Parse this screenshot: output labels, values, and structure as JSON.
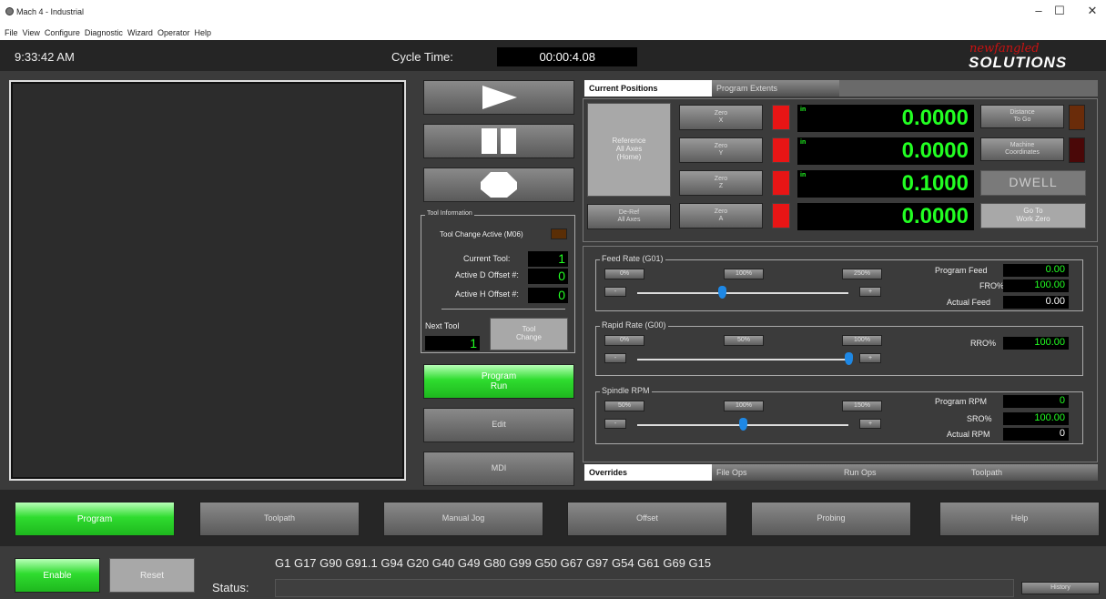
{
  "window": {
    "title": "Mach 4 - Industrial",
    "minimize": "–",
    "maximize": "☐",
    "close": "✕"
  },
  "menu": [
    "File",
    "View",
    "Configure",
    "Diagnostic",
    "Wizard",
    "Operator",
    "Help"
  ],
  "header": {
    "clock": "9:33:42 AM",
    "cycle_label": "Cycle Time:",
    "cycle_value": "00:00:4.08",
    "logo_top": "newfangled",
    "logo_bottom": "SOLUTIONS"
  },
  "controls": {
    "program_run": [
      "Program",
      "Run"
    ],
    "edit": "Edit",
    "mdi": "MDI"
  },
  "tool_info": {
    "legend": "Tool Information",
    "tool_change_active": "Tool Change Active (M06)",
    "current_tool_label": "Current Tool:",
    "current_tool": "1",
    "d_offset_label": "Active D Offset #:",
    "d_offset": "0",
    "h_offset_label": "Active H Offset #:",
    "h_offset": "0",
    "next_tool_label": "Next Tool",
    "next_tool": "1",
    "tool_change": [
      "Tool",
      "Change"
    ]
  },
  "positions": {
    "tabs": [
      "Current Positions",
      "Program Extents"
    ],
    "reference": [
      "Reference",
      "All Axes",
      "(Home)"
    ],
    "deref": [
      "De-Ref",
      "All Axes"
    ],
    "axes": [
      {
        "zero": [
          "Zero",
          "X"
        ],
        "unit": "in",
        "value": "0.0000"
      },
      {
        "zero": [
          "Zero",
          "Y"
        ],
        "unit": "in",
        "value": "0.0000"
      },
      {
        "zero": [
          "Zero",
          "Z"
        ],
        "unit": "in",
        "value": "0.1000"
      },
      {
        "zero": [
          "Zero",
          "A"
        ],
        "unit": "",
        "value": "0.0000"
      }
    ],
    "distance": [
      "Distance",
      "To Go"
    ],
    "machine": [
      "Machine",
      "Coordinates"
    ],
    "dwell": "DWELL",
    "goto": [
      "Go To",
      "Work Zero"
    ]
  },
  "feed": {
    "legend": "Feed Rate (G01)",
    "b1": "0%",
    "b2": "100%",
    "b3": "250%",
    "minus": "-",
    "plus": "+",
    "prog_label": "Program Feed",
    "prog": "0.00",
    "fro_label": "FRO%",
    "fro": "100.00",
    "actual_label": "Actual Feed",
    "actual": "0.00",
    "slider": 0.4
  },
  "rapid": {
    "legend": "Rapid Rate (G00)",
    "b1": "0%",
    "b2": "50%",
    "b3": "100%",
    "minus": "-",
    "plus": "+",
    "rro_label": "RRO%",
    "rro": "100.00",
    "slider": 1.0
  },
  "spindle": {
    "legend": "Spindle RPM",
    "b1": "50%",
    "b2": "100%",
    "b3": "150%",
    "minus": "-",
    "plus": "+",
    "prog_label": "Program RPM",
    "prog": "0",
    "sro_label": "SRO%",
    "sro": "100.00",
    "actual_label": "Actual RPM",
    "actual": "0",
    "slider": 0.5
  },
  "bottom_tabs": [
    "Overrides",
    "File Ops",
    "Run Ops",
    "Toolpath"
  ],
  "nav": [
    "Program",
    "Toolpath",
    "Manual Jog",
    "Offset",
    "Probing",
    "Help"
  ],
  "status": {
    "enable": "Enable",
    "reset": "Reset",
    "gcodes": "G1 G17 G90 G91.1 G94 G20 G40 G49 G80 G99 G50 G67 G97 G54 G61 G69 G15",
    "label": "Status:",
    "history": "History"
  },
  "colors": {
    "green": "#22ee22",
    "red": "#e81515",
    "panel": "#3b3b3b"
  }
}
